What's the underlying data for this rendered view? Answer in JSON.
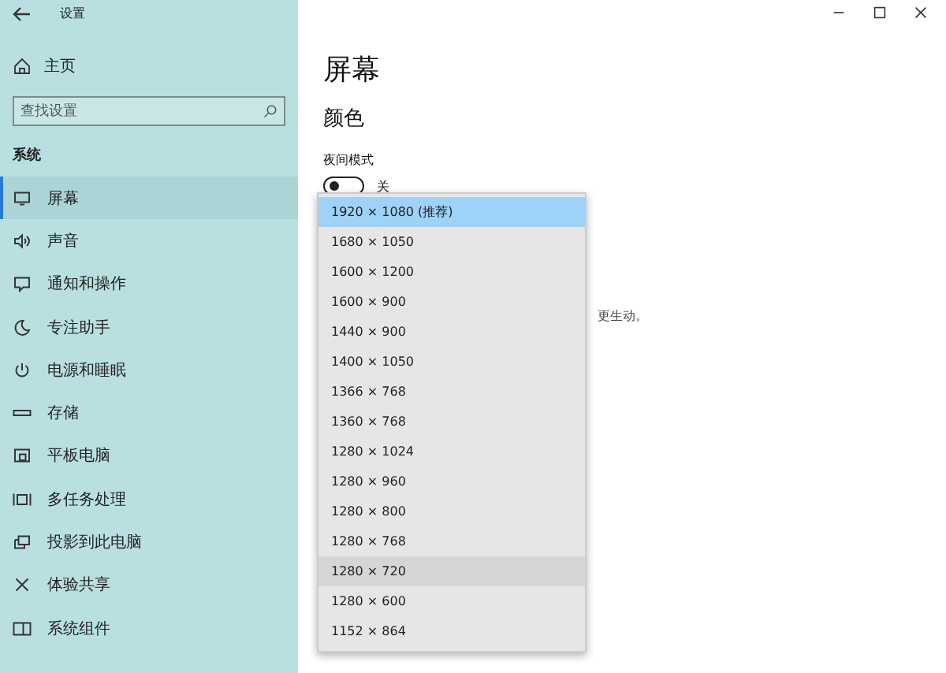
{
  "window": {
    "title": "设置"
  },
  "sidebar": {
    "home": "主页",
    "search": {
      "placeholder": "查找设置"
    },
    "section": "系统",
    "items": [
      {
        "label": "屏幕",
        "selected": true
      },
      {
        "label": "声音",
        "selected": false
      },
      {
        "label": "通知和操作",
        "selected": false
      },
      {
        "label": "专注助手",
        "selected": false
      },
      {
        "label": "电源和睡眠",
        "selected": false
      },
      {
        "label": "存储",
        "selected": false
      },
      {
        "label": "平板电脑",
        "selected": false
      },
      {
        "label": "多任务处理",
        "selected": false
      },
      {
        "label": "投影到此电脑",
        "selected": false
      },
      {
        "label": "体验共享",
        "selected": false
      },
      {
        "label": "系统组件",
        "selected": false
      }
    ]
  },
  "main": {
    "title": "屏幕",
    "section": "颜色",
    "night_mode": {
      "label": "夜间模式",
      "on": false,
      "state_text": "关"
    },
    "hidden_text": "更生动。"
  },
  "dropdown": {
    "options": [
      {
        "label": "1920 × 1080 (推荐)",
        "selected": true,
        "hovered": false
      },
      {
        "label": "1680 × 1050",
        "selected": false,
        "hovered": false
      },
      {
        "label": "1600 × 1200",
        "selected": false,
        "hovered": false
      },
      {
        "label": "1600 × 900",
        "selected": false,
        "hovered": false
      },
      {
        "label": "1440 × 900",
        "selected": false,
        "hovered": false
      },
      {
        "label": "1400 × 1050",
        "selected": false,
        "hovered": false
      },
      {
        "label": "1366 × 768",
        "selected": false,
        "hovered": false
      },
      {
        "label": "1360 × 768",
        "selected": false,
        "hovered": false
      },
      {
        "label": "1280 × 1024",
        "selected": false,
        "hovered": false
      },
      {
        "label": "1280 × 960",
        "selected": false,
        "hovered": false
      },
      {
        "label": "1280 × 800",
        "selected": false,
        "hovered": false
      },
      {
        "label": "1280 × 768",
        "selected": false,
        "hovered": false
      },
      {
        "label": "1280 × 720",
        "selected": false,
        "hovered": true
      },
      {
        "label": "1280 × 600",
        "selected": false,
        "hovered": false
      },
      {
        "label": "1152 × 864",
        "selected": false,
        "hovered": false
      }
    ]
  }
}
